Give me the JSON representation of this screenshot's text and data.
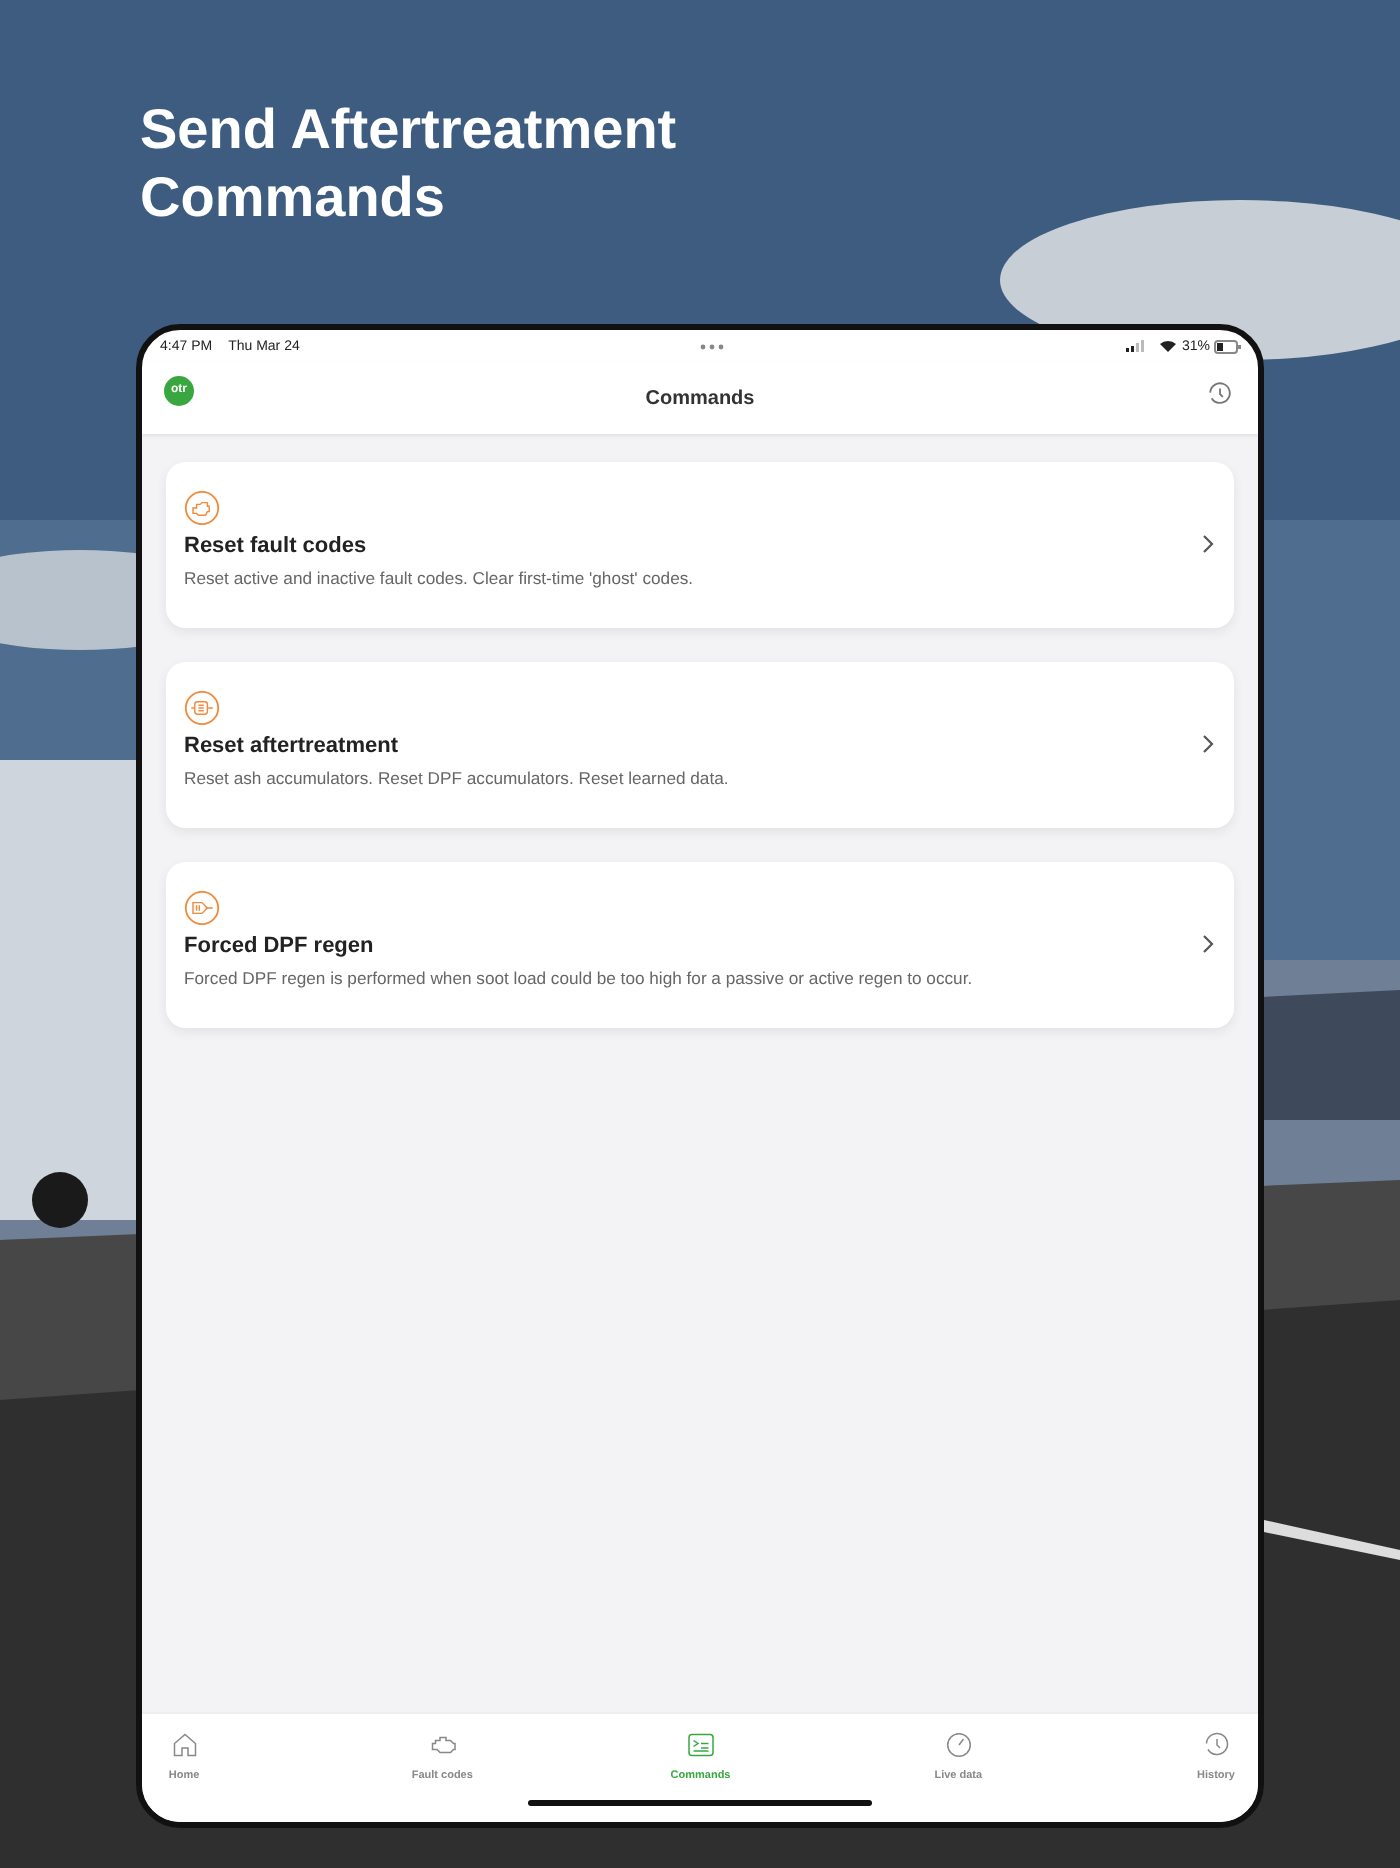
{
  "headline": "Send Aftertreatment Commands",
  "status_bar": {
    "time": "4:47 PM",
    "date": "Thu Mar 24",
    "battery": "31%"
  },
  "nav": {
    "logo": "otr",
    "title": "Commands"
  },
  "commands": [
    {
      "kind": "fault",
      "title": "Reset fault codes",
      "description": "Reset active and inactive fault codes. Clear first-time 'ghost' codes."
    },
    {
      "kind": "aftertreatment",
      "title": "Reset aftertreatment",
      "description": "Reset ash accumulators. Reset DPF accumulators. Reset learned data."
    },
    {
      "kind": "regen",
      "title": "Forced DPF regen",
      "description": "Forced DPF regen is performed when soot load could be too high for a passive or active regen to occur."
    }
  ],
  "tabs": [
    {
      "kind": "home",
      "label": "Home",
      "selected": false
    },
    {
      "kind": "engine",
      "label": "Fault codes",
      "selected": false
    },
    {
      "kind": "commands",
      "label": "Commands",
      "selected": true
    },
    {
      "kind": "gauge",
      "label": "Live data",
      "selected": false
    },
    {
      "kind": "history",
      "label": "History",
      "selected": false
    }
  ]
}
